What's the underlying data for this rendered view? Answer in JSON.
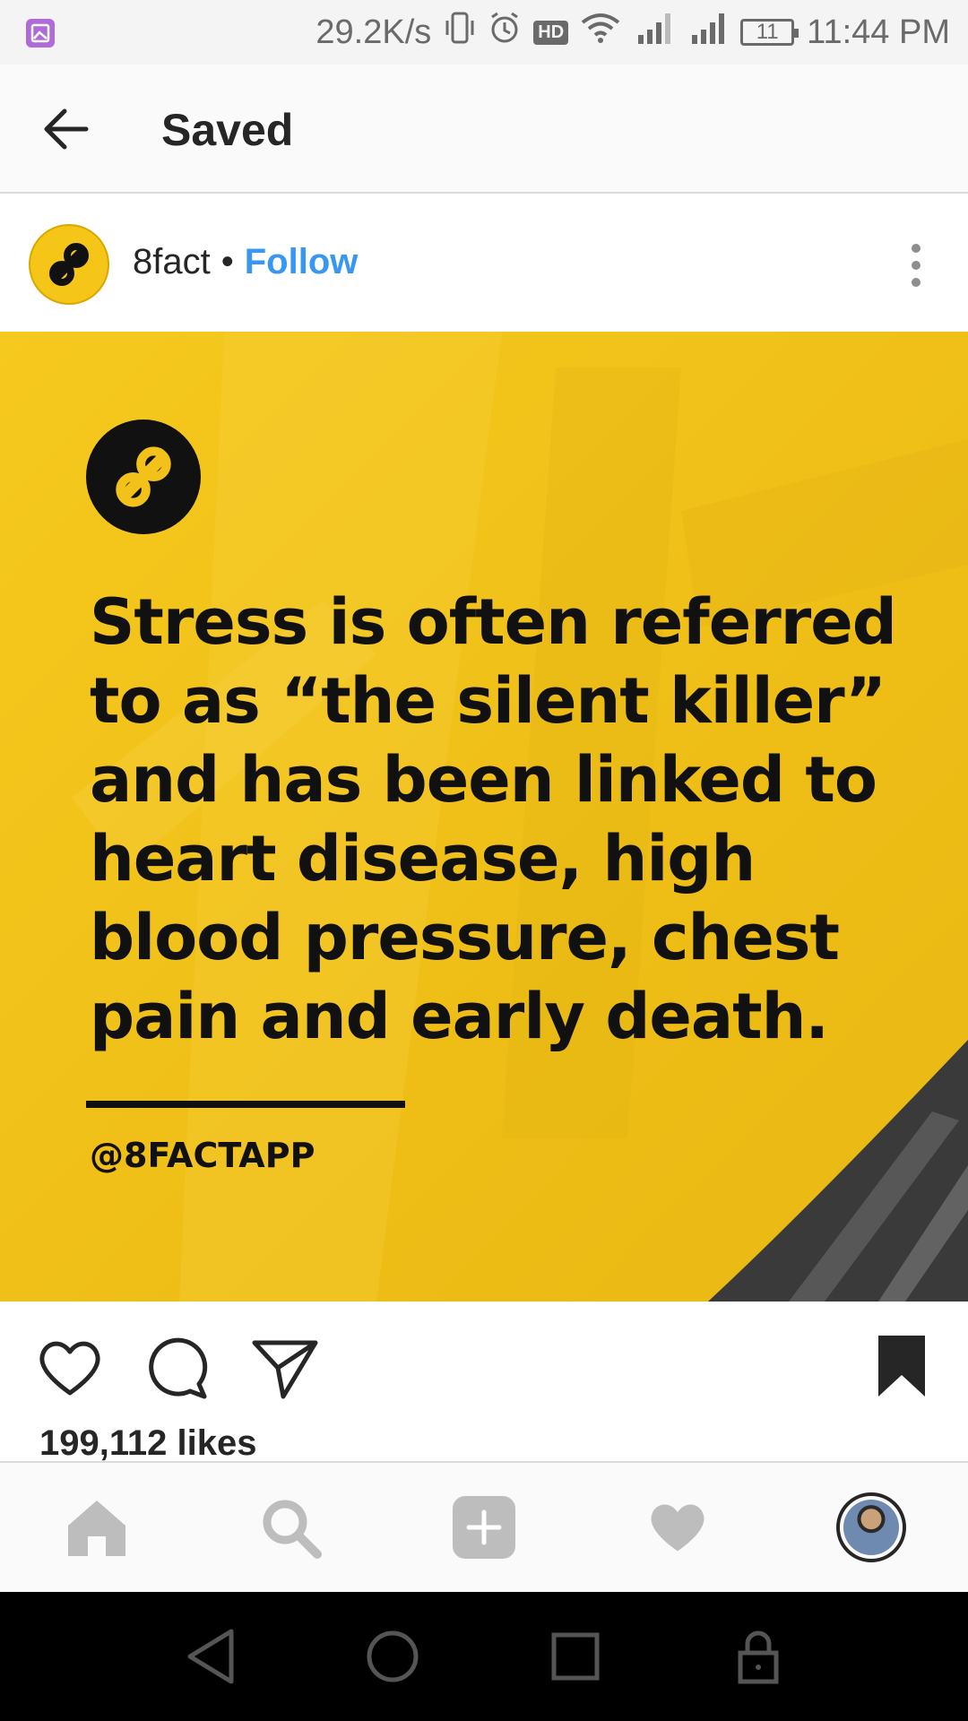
{
  "status_bar": {
    "network_speed": "29.2K/s",
    "hd_label": "HD",
    "battery_level": "11",
    "time": "11:44 PM"
  },
  "header": {
    "title": "Saved"
  },
  "post": {
    "account_name": "8fact",
    "separator": "•",
    "follow_label": "Follow",
    "quote": "Stress is often referred to as “the silent killer” and has been linked to heart disease, high blood pressure, chest pain and early death.",
    "handle": "@8FACTAPP",
    "likes": "199,112 likes",
    "bookmark_state": "saved"
  },
  "colors": {
    "brand_yellow": "#f2c21a",
    "follow_blue": "#3897f0",
    "text_dark": "#262626",
    "icon_gray": "#bdbdbd"
  },
  "icons": {
    "back": "arrow-left-icon",
    "more": "more-vertical-icon",
    "like": "heart-outline-icon",
    "comment": "comment-icon",
    "share": "send-icon",
    "save": "bookmark-filled-icon",
    "nav_home": "home-icon",
    "nav_search": "search-icon",
    "nav_add": "add-post-icon",
    "nav_activity": "heart-filled-icon",
    "nav_profile": "profile-avatar",
    "android_back": "triangle-back-icon",
    "android_home": "circle-home-icon",
    "android_recent": "square-recent-icon",
    "android_lock": "lock-icon"
  }
}
